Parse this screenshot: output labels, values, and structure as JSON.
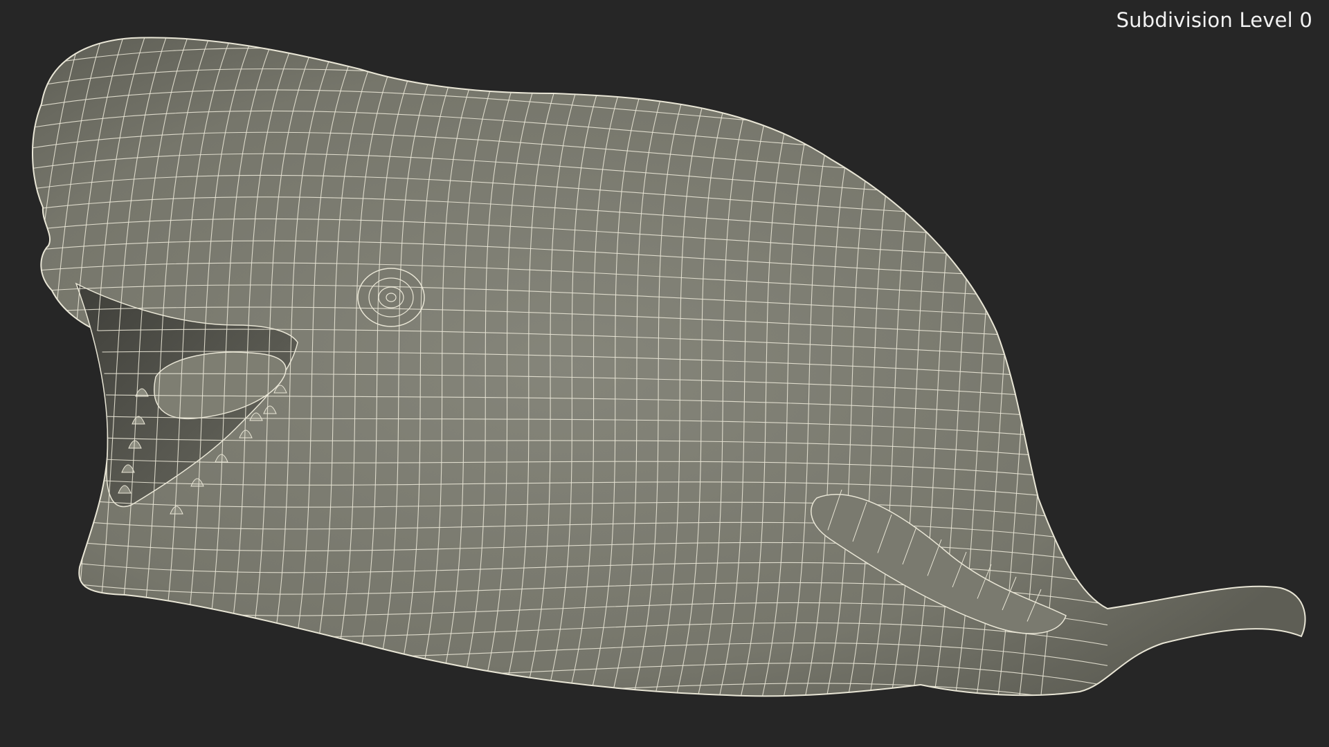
{
  "viewport": {
    "background_color": "#262626",
    "subdivision_label": "Subdivision Level 0"
  },
  "model": {
    "subject": "sperm-whale-wireframe-mesh",
    "surface_color": "#7c7c70",
    "wire_color": "#e9e6d6"
  }
}
